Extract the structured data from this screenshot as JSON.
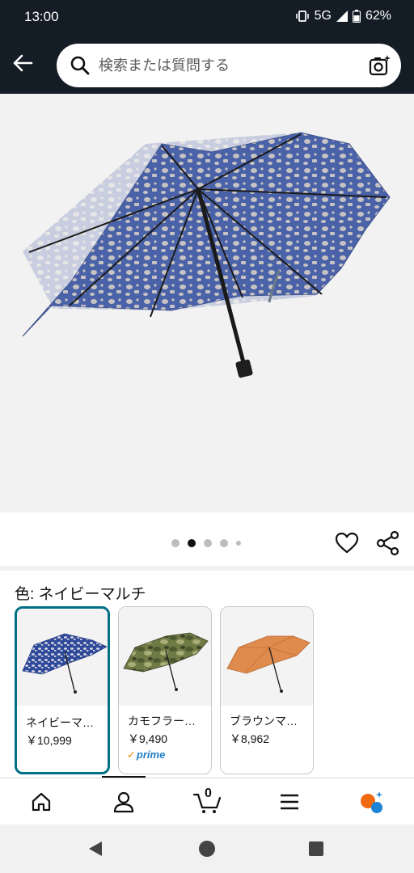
{
  "status_bar": {
    "time": "13:00",
    "network": "5G",
    "battery": "62%"
  },
  "search": {
    "placeholder": "検索または質問する"
  },
  "product": {
    "image_count": 5,
    "active_image_index": 1
  },
  "color_selection": {
    "label": "色: ネイビーマルチ",
    "variants": [
      {
        "name": "ネイビーマ…",
        "price": "￥10,999",
        "prime": false,
        "selected": true
      },
      {
        "name": "カモフラー…",
        "price": "￥9,490",
        "prime": true,
        "prime_label": "prime",
        "selected": false
      },
      {
        "name": "ブラウンマ…",
        "price": "￥8,962",
        "prime": false,
        "selected": false
      }
    ]
  },
  "bottom_nav": {
    "items": [
      "home-icon",
      "account-icon",
      "cart-icon",
      "menu-icon",
      "ai-assistant-icon"
    ],
    "cart_count": "0",
    "active_index": 1
  },
  "colors": {
    "header_bg": "#141c25",
    "selected_border": "#007185",
    "prime_blue": "#1f7ec7",
    "prime_check": "#f08804"
  }
}
